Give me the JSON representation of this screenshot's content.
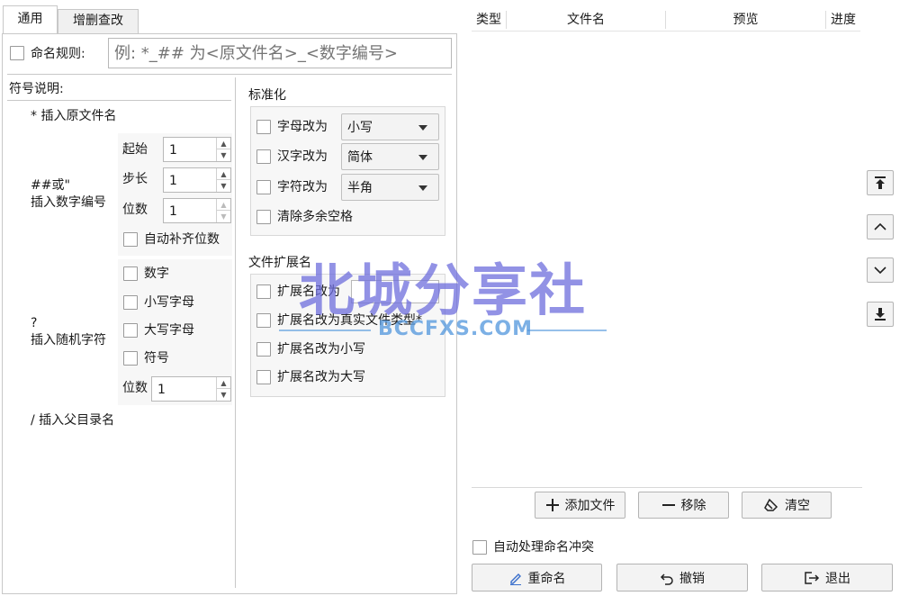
{
  "tabs": [
    {
      "label": "通用",
      "active": true
    },
    {
      "label": "增删查改",
      "active": false
    }
  ],
  "naming_rule": {
    "label": "命名规则:",
    "placeholder": "例: *_## 为<原文件名>_<数字编号>"
  },
  "symbols": {
    "header": "符号说明:",
    "original_name": "* 插入原文件名",
    "number_symbol": "##或\"",
    "number_desc": "插入数字编号",
    "start_label": "起始",
    "start_value": "1",
    "step_label": "步长",
    "step_value": "1",
    "digits_label": "位数",
    "digits_value": "1",
    "auto_pad": "自动补齐位数",
    "random_symbol": "?",
    "random_desc": "插入随机字符",
    "random_options": [
      "数字",
      "小写字母",
      "大写字母",
      "符号"
    ],
    "random_digits_label": "位数",
    "random_digits_value": "1",
    "parent_dir": "/ 插入父目录名"
  },
  "normalize": {
    "title": "标准化",
    "letters_label": "字母改为",
    "letters_value": "小写",
    "chinese_label": "汉字改为",
    "chinese_value": "简体",
    "chars_label": "字符改为",
    "chars_value": "半角",
    "clear_spaces": "清除多余空格"
  },
  "extension": {
    "title": "文件扩展名",
    "change_to": "扩展名改为",
    "to_real_type": "扩展名改为真实文件类型*",
    "to_lower": "扩展名改为小写",
    "to_upper": "扩展名改为大写"
  },
  "file_table": {
    "columns": [
      "类型",
      "文件名",
      "预览",
      "进度"
    ]
  },
  "list_buttons": {
    "add": "添加文件",
    "remove": "移除",
    "clear": "清空"
  },
  "auto_conflict": "自动处理命名冲突",
  "bottom_buttons": {
    "rename": "重命名",
    "undo": "撤销",
    "exit": "退出"
  },
  "nav_icons": [
    "move-top-icon",
    "move-up-icon",
    "move-down-icon",
    "move-bottom-icon"
  ],
  "watermark": {
    "main": "北城分享社",
    "sub": "BCCFXS.COM"
  },
  "colors": {
    "border": "#c8c8c8",
    "group_bg": "#f7f7f7",
    "watermark_main": "#6e6edc",
    "watermark_sub": "#5096dc"
  }
}
